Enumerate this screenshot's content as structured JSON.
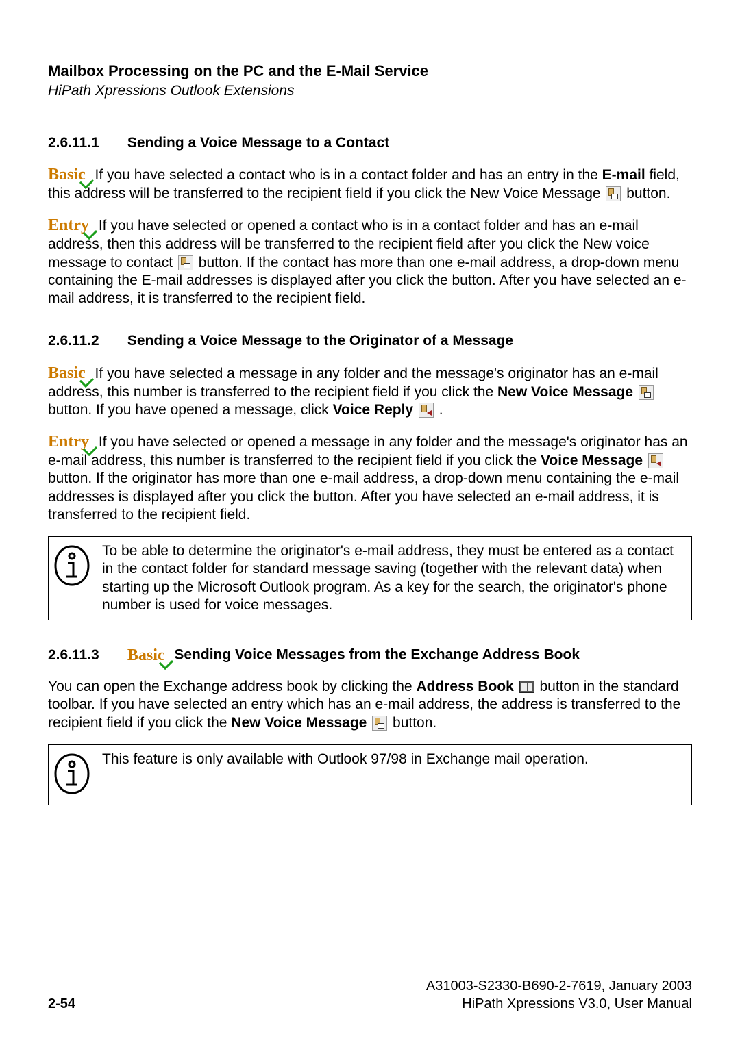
{
  "header": {
    "title": "Mailbox Processing on the PC and the E-Mail Service",
    "subtitle": "HiPath Xpressions Outlook Extensions"
  },
  "sections": {
    "s1": {
      "num": "2.6.11.1",
      "title": "Sending a Voice Message to a Contact",
      "basic_tag": "Basic",
      "p1a": "If you have selected a contact who is in a contact folder and has an entry in the ",
      "p1b_bold": "E-mail",
      "p1c": " field, this address will be transferred to the recipient field if you click the New Voice Message ",
      "p1d": " button.",
      "entry_tag": "Entry",
      "p2a": "If you have selected or opened a contact who is in a contact folder and has an e-mail address, then this address will be transferred to the recipient field after you click the New voice message to contact ",
      "p2b": " button. If the contact has more than one e-mail address, a drop-down menu containing the E-mail addresses is displayed after you click the button. After you have selected an e-mail address, it is transferred to the recipient field."
    },
    "s2": {
      "num": "2.6.11.2",
      "title": "Sending a Voice Message to the Originator of a Message",
      "basic_tag": "Basic",
      "p1a": "If you have selected a message in any folder and the message's originator has an e-mail address, this number is transferred to the recipient field if you click the ",
      "p1b_bold": "New Voice Message",
      "p1c": " button. If you have opened a message, click ",
      "p1d_bold": "Voice Reply",
      "p1e": " .",
      "entry_tag": "Entry",
      "p2a": "If you have selected or opened a message in any folder and the message's originator has an e-mail address, this number is transferred to the recipient field if you click the ",
      "p2b_bold": "Voice Message",
      "p2c": " button. If the originator has more than one e-mail address, a drop-down menu containing the e-mail addresses is displayed after you click the button. After you have selected an e-mail address, it is transferred to the recipient field.",
      "note": "To be able to determine the originator's e-mail address, they must be entered as a contact in the contact folder for standard message saving (together with the relevant data) when starting up the Microsoft Outlook program. As a key for the search, the originator's phone number is used for voice messages."
    },
    "s3": {
      "num": "2.6.11.3",
      "basic_tag": "Basic",
      "title": "Sending Voice Messages from the Exchange Address Book",
      "p1a": "You can open the Exchange address book by clicking the ",
      "p1b_bold": "Address Book",
      "p1c": " button in the standard toolbar. If you have selected an entry which has an e-mail address, the address is transferred to the recipient field if you click the ",
      "p1d_bold": "New Voice Message",
      "p1e": " button.",
      "note": "This feature is only available with Outlook 97/98 in Exchange mail operation."
    }
  },
  "footer": {
    "page": "2-54",
    "docref": "A31003-S2330-B690-2-7619, January 2003",
    "product": "HiPath Xpressions V3.0, User Manual"
  }
}
